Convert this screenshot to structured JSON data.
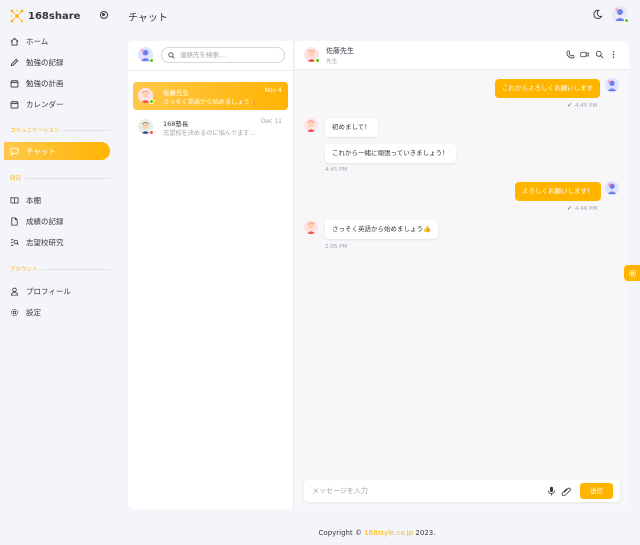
{
  "brand": {
    "name": "168share"
  },
  "page": {
    "title": "チャット"
  },
  "sidebar": {
    "items": [
      {
        "label": "ホーム",
        "icon": "home-icon"
      },
      {
        "label": "勉強の記録",
        "icon": "pencil-icon"
      },
      {
        "label": "勉強の計画",
        "icon": "calendar-icon"
      },
      {
        "label": "カレンダー",
        "icon": "calendar-icon"
      },
      {
        "label": "チャット",
        "icon": "chat-icon",
        "active": true
      },
      {
        "label": "本棚",
        "icon": "book-icon"
      },
      {
        "label": "成績の記録",
        "icon": "document-icon"
      },
      {
        "label": "志望校研究",
        "icon": "search-icon"
      },
      {
        "label": "プロフィール",
        "icon": "person-icon"
      },
      {
        "label": "設定",
        "icon": "gear-icon"
      }
    ],
    "sections": {
      "communication": "コミュニケーション",
      "research": "研究",
      "account": "アカウント"
    }
  },
  "search": {
    "placeholder": "連絡先を検索..."
  },
  "contacts": [
    {
      "name": "佐藤先生",
      "preview": "さっそく英語から始めましょう👍",
      "date": "Nov 4",
      "active": true,
      "status": "online"
    },
    {
      "name": "168塾長",
      "preview": "志望校を決めるのに悩んでます…",
      "date": "Dec 11",
      "active": false,
      "status": "offline"
    }
  ],
  "chat": {
    "name": "佐藤先生",
    "role": "先生",
    "messages": [
      {
        "direction": "out",
        "text": "これからよろしくお願いします",
        "time": "4:45 PM"
      },
      {
        "direction": "in",
        "text": "初めまして！"
      },
      {
        "direction": "in",
        "text": "これから一緒に頑張っていきましょう！",
        "time": "4:45 PM"
      },
      {
        "direction": "out",
        "text": "よろしくお願いします！",
        "time": "4:46 PM"
      },
      {
        "direction": "in",
        "text": "さっそく英語から始めましょう👍",
        "time": "2:05 PM"
      }
    ],
    "composer_placeholder": "メッセージを入力",
    "send_label": "送信"
  },
  "footer": {
    "prefix": "Copyright © ",
    "link": "168style.co.jp",
    "suffix": " 2023."
  },
  "colors": {
    "accent": "#ffb400",
    "online": "#56ca00",
    "offline": "#ff4c51"
  }
}
